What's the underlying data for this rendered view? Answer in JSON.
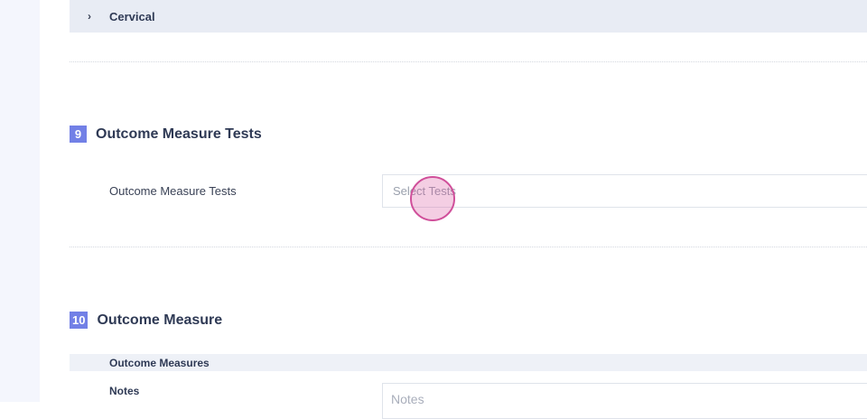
{
  "left_rail": {},
  "collapsed_region": {
    "chevron": "›",
    "label": "Cervical"
  },
  "section9": {
    "number": "9",
    "title": "Outcome Measure Tests",
    "field_label": "Outcome Measure Tests",
    "select_placeholder": "Select Tests"
  },
  "section10": {
    "number": "10",
    "title": "Outcome Measure",
    "subheader": "Outcome Measures",
    "notes_label": "Notes",
    "notes_placeholder": "Notes"
  },
  "colors": {
    "accent": "#7280e6",
    "cursor": "#d04f9a",
    "row_bg": "#e8ecf4"
  }
}
